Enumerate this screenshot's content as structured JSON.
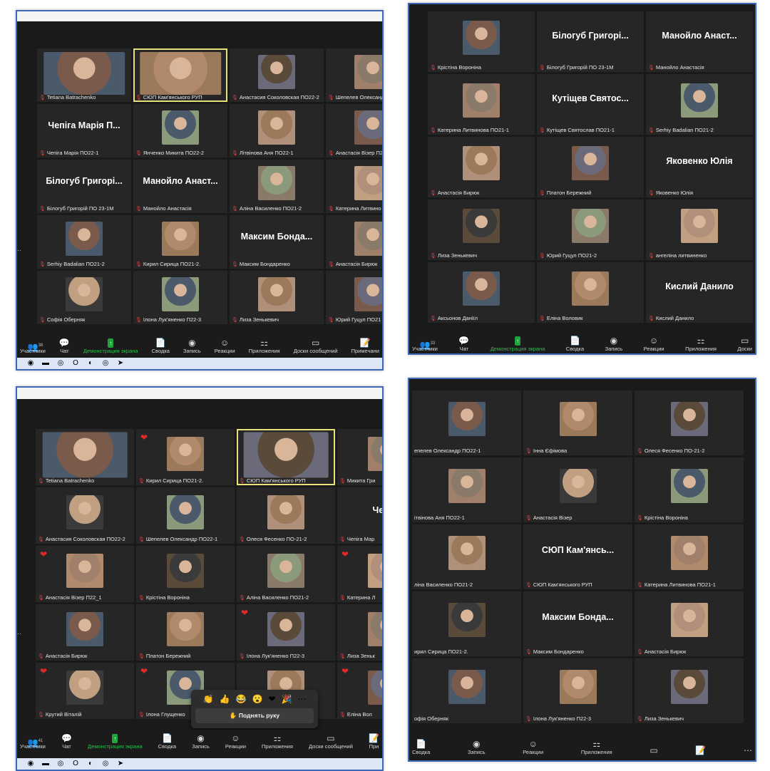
{
  "colors": {
    "frame": "#3c68b5",
    "tile": "#262626",
    "speaker_outline": "#e6e27a",
    "muted": "#e04040",
    "share_green": "#1fa33c",
    "heart": "#e32828"
  },
  "shot1": {
    "tiles": [
      {
        "name": "Tetiana Batrachenko",
        "photo": true
      },
      {
        "name": "СЮП Кам'янського РУП",
        "photo": true,
        "speaking": true
      },
      {
        "name": "Анастасия Соколовская ПО22-2",
        "photo": true
      },
      {
        "name": "Шепелев Олександ",
        "photo": true
      },
      {
        "name": "Чепіга Марія ПО22-1",
        "big": "Чепіга Марія П..."
      },
      {
        "name": "Янченко Микита ПО22-2",
        "photo": true
      },
      {
        "name": "Лiтвінова Аня ПО22-1",
        "photo": true
      },
      {
        "name": "Анастасія Візер П2",
        "photo": true
      },
      {
        "name": "Білогуб Григорій ПО 23-1М",
        "big": "Білогуб Григорі..."
      },
      {
        "name": "Манойло Анастасія",
        "big": "Манойло Анаст..."
      },
      {
        "name": "Аліна Василенко ПО21-2",
        "photo": true
      },
      {
        "name": "Катерина Литвино",
        "photo": true
      },
      {
        "name": "Serhiy Badalian ПО21-2",
        "photo": true
      },
      {
        "name": "Кирил Сирица ПО21-2.",
        "photo": true
      },
      {
        "name": "Максим Бондаренко",
        "big": "Максим Бонда..."
      },
      {
        "name": "Анастасія Бирюк",
        "photo": true
      },
      {
        "name": "Софія Оберняк",
        "photo": true
      },
      {
        "name": "Ілона Лук'яненко П22-3",
        "photo": true
      },
      {
        "name": "Лиза Зенькевич",
        "photo": true
      },
      {
        "name": "Юрий Гуцул ПО21",
        "photo": true
      }
    ],
    "controls": [
      {
        "icon": "participants-icon",
        "glyph": "👥",
        "label": "Участники",
        "count": "38"
      },
      {
        "icon": "chat-icon",
        "glyph": "💬",
        "label": "Чат"
      },
      {
        "icon": "share-screen-icon",
        "glyph": "↑",
        "label": "Демонстрация экрана",
        "green": true
      },
      {
        "icon": "summary-icon",
        "glyph": "📄",
        "label": "Сводка"
      },
      {
        "icon": "record-icon",
        "glyph": "◉",
        "label": "Запись"
      },
      {
        "icon": "reactions-icon",
        "glyph": "☺",
        "label": "Реакции"
      },
      {
        "icon": "apps-icon",
        "glyph": "⚏",
        "label": "Приложения"
      },
      {
        "icon": "whiteboards-icon",
        "glyph": "▭",
        "label": "Доски сообщений"
      },
      {
        "icon": "notes-icon",
        "glyph": "📝",
        "label": "Примечани"
      }
    ]
  },
  "shot2": {
    "tiles": [
      {
        "name": "Крістіна Вороніна",
        "photo": true
      },
      {
        "name": "Білогуб Григорій ПО 23-1М",
        "big": "Білогуб Григорі..."
      },
      {
        "name": "Манойло Анастасія",
        "big": "Манойло Анаст..."
      },
      {
        "name": "Катерина Литвинова ПО21-1",
        "photo": true
      },
      {
        "name": "Кутіщев Святослав ПО21-1",
        "big": "Кутіщев Святос..."
      },
      {
        "name": "Serhiy Badalian ПО21-2",
        "photo": true
      },
      {
        "name": "Анастасія Бирюк",
        "photo": true
      },
      {
        "name": "Платон Бережний",
        "photo": true
      },
      {
        "name": "Яковенко Юлія",
        "big": "Яковенко Юлія"
      },
      {
        "name": "Лиза Зенькевич",
        "photo": true
      },
      {
        "name": "Юрий Гуцул ПО21-2",
        "photo": true
      },
      {
        "name": "ангеліна литвиненко",
        "photo": true
      },
      {
        "name": "Аксьонов Даніїл",
        "photo": true
      },
      {
        "name": "Еліна Воловик",
        "photo": true
      },
      {
        "name": "Кислий Данило",
        "big": "Кислий Данило"
      }
    ],
    "controls": [
      {
        "icon": "participants-icon",
        "glyph": "👥",
        "label": "Участники",
        "count": "33"
      },
      {
        "icon": "chat-icon",
        "glyph": "💬",
        "label": "Чат"
      },
      {
        "icon": "share-screen-icon",
        "glyph": "↑",
        "label": "Демонстрация экрана",
        "green": true
      },
      {
        "icon": "summary-icon",
        "glyph": "📄",
        "label": "Сводка"
      },
      {
        "icon": "record-icon",
        "glyph": "◉",
        "label": "Запись"
      },
      {
        "icon": "reactions-icon",
        "glyph": "☺",
        "label": "Реакции"
      },
      {
        "icon": "apps-icon",
        "glyph": "⚏",
        "label": "Приложения"
      },
      {
        "icon": "whiteboards-icon",
        "glyph": "▭",
        "label": "Доски"
      }
    ]
  },
  "shot3": {
    "tiles": [
      {
        "name": "Tetiana Batrachenko",
        "photo": true
      },
      {
        "name": "Кирил Сирица ПО21-2.",
        "photo": true,
        "heart": true
      },
      {
        "name": "СЮП Кам'янського РУП",
        "photo": true,
        "speaking": true
      },
      {
        "name": "Микита Гри",
        "photo": true
      },
      {
        "name": "Анастасия Соколовская ПО22-2",
        "photo": true
      },
      {
        "name": "Шепелев Олександр ПО22-1",
        "photo": true
      },
      {
        "name": "Олеся Фесенко ПО-21-2",
        "photo": true
      },
      {
        "name": "Чепіга Мар",
        "big": "Чепіга"
      },
      {
        "name": "Анастасія Візер П22_1",
        "photo": true,
        "heart": true
      },
      {
        "name": "Крістіна Вороніна",
        "photo": true
      },
      {
        "name": "Аліна Василенко ПО21-2",
        "photo": true
      },
      {
        "name": "Катерина Л",
        "photo": true,
        "heart": true
      },
      {
        "name": "Анастасія Бирюк",
        "photo": true
      },
      {
        "name": "Платон Бережний",
        "photo": true
      },
      {
        "name": "Ілона Лук'яненко П22-3",
        "photo": true,
        "heart": true
      },
      {
        "name": "Лиза Зеньк",
        "photo": true
      },
      {
        "name": "Крутий Віталій",
        "photo": true,
        "heart": true
      },
      {
        "name": "Ілона Глущенко",
        "photo": true,
        "heart": true
      },
      {
        "name": "",
        "photo": true
      },
      {
        "name": "Еліна Вол",
        "photo": true,
        "heart": true
      }
    ],
    "reactions": [
      "👏",
      "👍",
      "😂",
      "😮",
      "❤",
      "🎉",
      "⋯"
    ],
    "raise_hand": "✋ Поднять руку",
    "controls": [
      {
        "icon": "participants-icon",
        "glyph": "👥",
        "label": "Участники",
        "count": "41"
      },
      {
        "icon": "chat-icon",
        "glyph": "💬",
        "label": "Чат"
      },
      {
        "icon": "share-screen-icon",
        "glyph": "↑",
        "label": "Демонстрация экрана",
        "green": true
      },
      {
        "icon": "summary-icon",
        "glyph": "📄",
        "label": "Сводка"
      },
      {
        "icon": "record-icon",
        "glyph": "◉",
        "label": "Запись"
      },
      {
        "icon": "reactions-icon",
        "glyph": "☺",
        "label": "Реакции"
      },
      {
        "icon": "apps-icon",
        "glyph": "⚏",
        "label": "Приложения"
      },
      {
        "icon": "whiteboards-icon",
        "glyph": "▭",
        "label": "Доски сообщений"
      },
      {
        "icon": "notes-icon",
        "glyph": "📝",
        "label": "При"
      }
    ]
  },
  "shot4": {
    "tiles": [
      {
        "name": "епелев Олександр ПО22-1",
        "photo": true,
        "nomic": true
      },
      {
        "name": "Інна Єфімова",
        "photo": true
      },
      {
        "name": "Олеся Фесенко ПО-21-2",
        "photo": true
      },
      {
        "name": "ітвінова Аня ПО22-1",
        "photo": true,
        "nomic": true
      },
      {
        "name": "Анастасія Візер",
        "photo": true
      },
      {
        "name": "Крістіна Вороніна",
        "photo": true
      },
      {
        "name": "ліна Василенко ПО21-2",
        "photo": true,
        "nomic": true
      },
      {
        "name": "СЮП Кам'янського РУП",
        "big": "СЮП Кам'янсь..."
      },
      {
        "name": "Катерина Литвинова ПО21-1",
        "photo": true
      },
      {
        "name": "ирил Сирица ПО21-2.",
        "photo": true,
        "nomic": true
      },
      {
        "name": "Максим Бондаренко",
        "big": "Максим Бонда..."
      },
      {
        "name": "Анастасія Бирюк",
        "photo": true
      },
      {
        "name": "офія Оберняк",
        "photo": true,
        "nomic": true
      },
      {
        "name": "Ілона Лук'яненко П22-3",
        "photo": true
      },
      {
        "name": "Лиза Зенькевич",
        "photo": true
      }
    ],
    "controls": [
      {
        "icon": "summary-icon",
        "glyph": "📄",
        "label": "Сводка"
      },
      {
        "icon": "record-icon",
        "glyph": "◉",
        "label": "Запись"
      },
      {
        "icon": "reactions-icon",
        "glyph": "☺",
        "label": "Реакции"
      },
      {
        "icon": "apps-icon",
        "glyph": "⚏",
        "label": "Приложения"
      },
      {
        "icon": "whiteboards-icon",
        "glyph": "▭",
        "label": ""
      },
      {
        "icon": "notes-icon",
        "glyph": "📝",
        "label": ""
      },
      {
        "icon": "more-icon",
        "glyph": "⋯",
        "label": ""
      }
    ]
  },
  "taskbar": [
    {
      "icon": "viber-icon",
      "glyph": "◉"
    },
    {
      "icon": "folder-icon",
      "glyph": "▬"
    },
    {
      "icon": "chrome-icon",
      "glyph": "◎"
    },
    {
      "icon": "opera-icon",
      "glyph": "O"
    },
    {
      "icon": "firefox-icon",
      "glyph": "◐"
    },
    {
      "icon": "chrome-icon",
      "glyph": "◎"
    },
    {
      "icon": "telegram-icon",
      "glyph": "➤"
    }
  ]
}
